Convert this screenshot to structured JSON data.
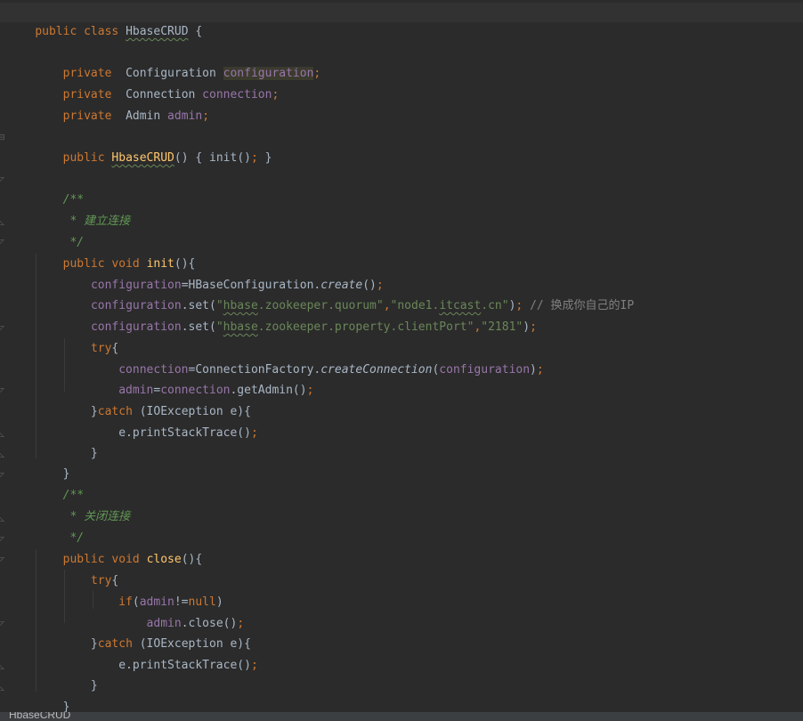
{
  "editor": {
    "code_lines": [
      "public class HbaseCRUD {",
      "    private  Configuration configuration;",
      "    private  Connection connection;",
      "    private  Admin admin;",
      "    public HbaseCRUD() { init(); }",
      "    /**",
      "     * 建立连接",
      "     */",
      "    public void init(){",
      "        configuration=HBaseConfiguration.create();",
      "        configuration.set(\"hbase.zookeeper.quorum\",\"node1.itcast.cn\"); // 换成你自己的IP",
      "        configuration.set(\"hbase.zookeeper.property.clientPort\",\"2181\");",
      "        try{",
      "            connection=ConnectionFactory.createConnection(configuration);",
      "            admin=connection.getAdmin();",
      "        }catch (IOException e){",
      "            e.printStackTrace();",
      "        }",
      "    }",
      "    /**",
      "     * 关闭连接",
      "     */",
      "    public void close(){",
      "        try{",
      "            if(admin!=null)",
      "                admin.close();",
      "        }catch (IOException e){",
      "            e.printStackTrace();",
      "        }",
      "    }",
      "    /**"
    ]
  },
  "status_bar": {
    "breadcrumb": "HbaseCRUD"
  },
  "colors": {
    "background": "#2b2b2b",
    "keyword": "#cc7832",
    "field": "#9876aa",
    "method_declaration": "#ffc66d",
    "string": "#6a8759",
    "doc_comment": "#629755",
    "line_comment": "#808080",
    "plain_text": "#a9b7c6"
  }
}
